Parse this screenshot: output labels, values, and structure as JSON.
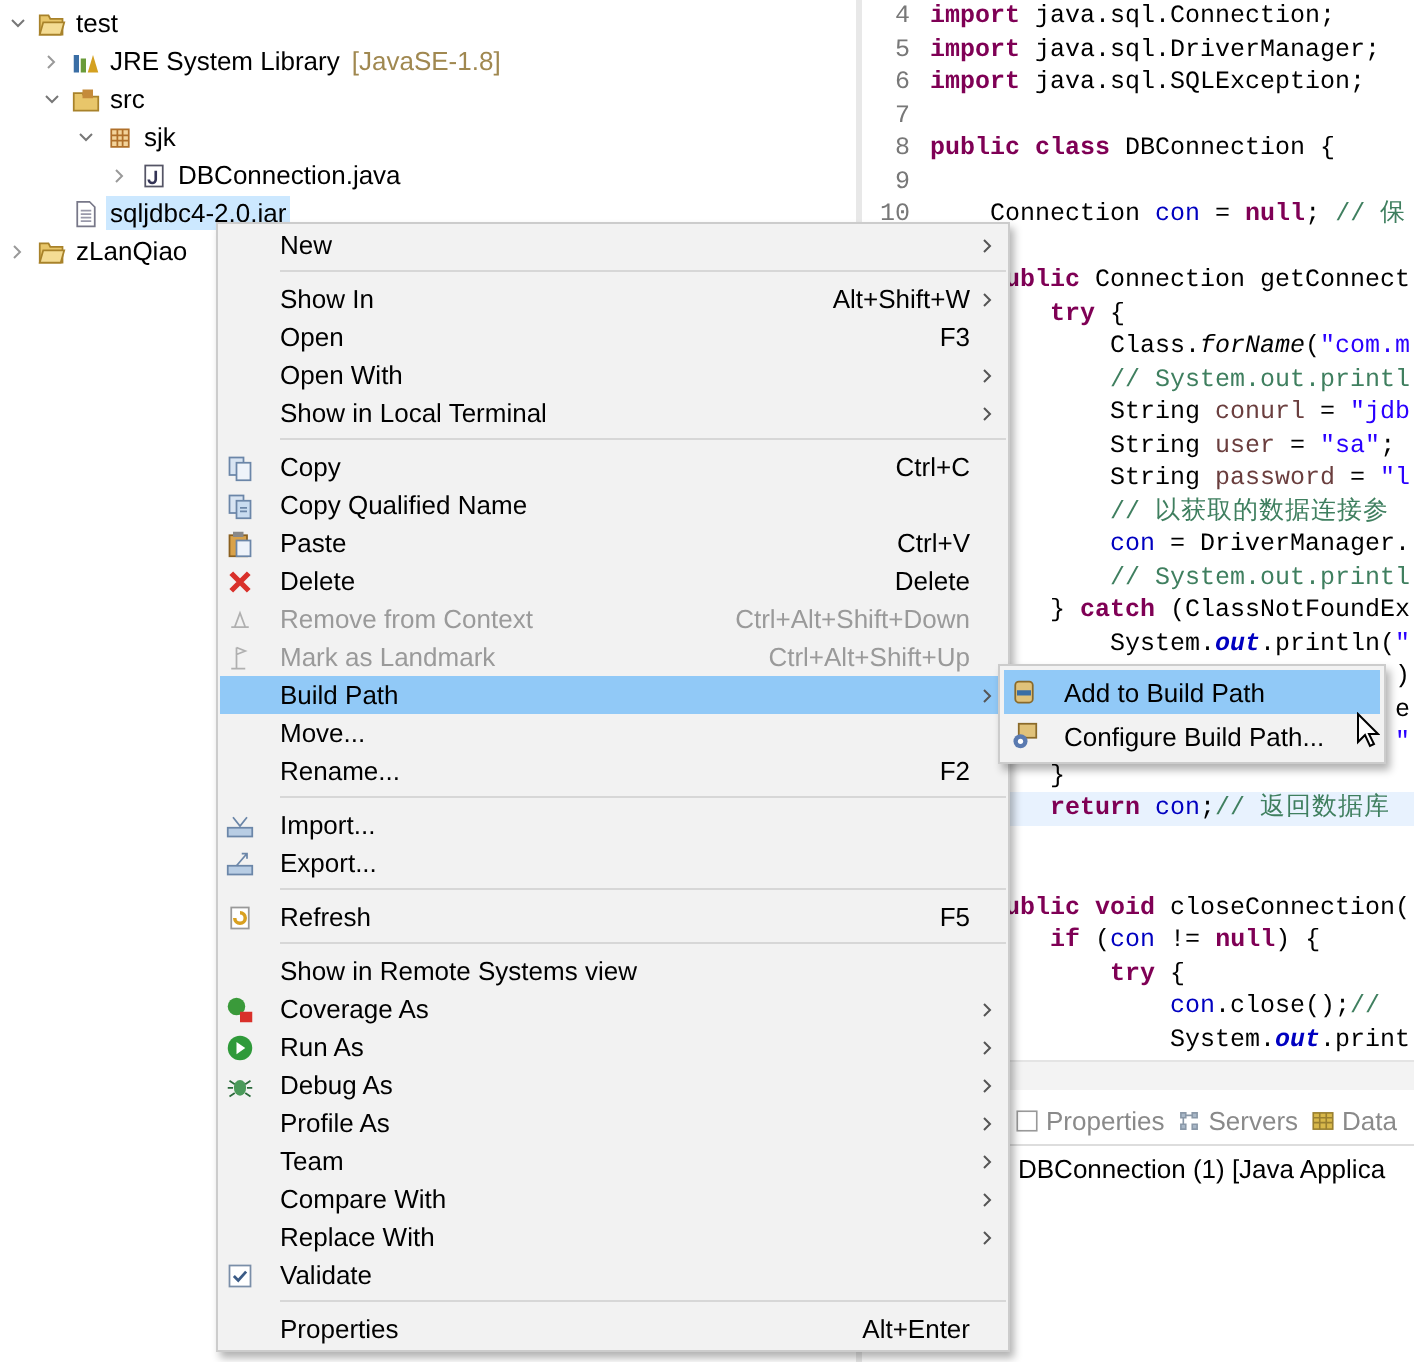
{
  "tree": [
    {
      "label": "test",
      "kind": "project",
      "expanded": true,
      "selected": false,
      "children": [
        {
          "label": "JRE System Library",
          "decoration": "[JavaSE-1.8]",
          "kind": "library",
          "expanded": false,
          "selected": false
        },
        {
          "label": "src",
          "kind": "source",
          "expanded": true,
          "selected": false,
          "children": [
            {
              "label": "sjk",
              "kind": "package",
              "expanded": true,
              "selected": false,
              "children": [
                {
                  "label": "DBConnection.java",
                  "kind": "java",
                  "expanded": false,
                  "selected": false
                }
              ]
            }
          ]
        },
        {
          "label": "sqljdbc4-2.0.jar",
          "kind": "file",
          "selected": true
        }
      ]
    },
    {
      "label": "zLanQiao",
      "kind": "project",
      "expanded": false,
      "selected": false
    }
  ],
  "editor": {
    "lines": [
      {
        "n": "4",
        "current": false,
        "t": [
          {
            "kind": "kw",
            "text": "import"
          },
          {
            "kind": "plain",
            "text": " java.sql.Connection;"
          }
        ]
      },
      {
        "n": "5",
        "current": false,
        "t": [
          {
            "kind": "kw",
            "text": "import"
          },
          {
            "kind": "plain",
            "text": " java.sql.DriverManager;"
          }
        ]
      },
      {
        "n": "6",
        "current": false,
        "t": [
          {
            "kind": "kw",
            "text": "import"
          },
          {
            "kind": "plain",
            "text": " java.sql.SQLException;"
          }
        ]
      },
      {
        "n": "7",
        "current": false
      },
      {
        "n": "8",
        "current": false,
        "t": [
          {
            "kind": "kw",
            "text": "public class"
          },
          {
            "kind": "plain",
            "text": " DBConnection {"
          }
        ]
      },
      {
        "n": "9",
        "current": false
      },
      {
        "n": "10",
        "current": false,
        "t": [
          {
            "kind": "plain",
            "text": "    Connection "
          },
          {
            "kind": "field",
            "text": "con"
          },
          {
            "kind": "plain",
            "text": " = "
          },
          {
            "kind": "kw",
            "text": "null"
          },
          {
            "kind": "plain",
            "text": "; "
          },
          {
            "kind": "comment",
            "text": "// 保"
          }
        ]
      },
      {
        "current": false
      },
      {
        "current": false,
        "t": [
          {
            "kind": "kw",
            "text": "     ublic"
          },
          {
            "kind": "plain",
            "text": " Connection getConnect"
          }
        ]
      },
      {
        "current": false,
        "t": [
          {
            "kind": "kw",
            "text": "        try"
          },
          {
            "kind": "plain",
            "text": " {"
          }
        ]
      },
      {
        "current": false,
        "t": [
          {
            "kind": "plain",
            "text": "            Class."
          },
          {
            "kind": "method",
            "text": "forName"
          },
          {
            "kind": "plain",
            "text": "("
          },
          {
            "kind": "str",
            "text": "\"com.m"
          }
        ]
      },
      {
        "current": false,
        "t": [
          {
            "kind": "comment",
            "text": "            // System.out.printl"
          }
        ]
      },
      {
        "current": false,
        "t": [
          {
            "kind": "plain",
            "text": "            String "
          },
          {
            "kind": "var",
            "text": "conurl"
          },
          {
            "kind": "plain",
            "text": " = "
          },
          {
            "kind": "str",
            "text": "\"jdb"
          }
        ]
      },
      {
        "current": false,
        "t": [
          {
            "kind": "plain",
            "text": "            String "
          },
          {
            "kind": "var",
            "text": "user"
          },
          {
            "kind": "plain",
            "text": " = "
          },
          {
            "kind": "str",
            "text": "\"sa\""
          },
          {
            "kind": "plain",
            "text": ";"
          }
        ]
      },
      {
        "current": false,
        "t": [
          {
            "kind": "plain",
            "text": "            String "
          },
          {
            "kind": "var",
            "text": "password"
          },
          {
            "kind": "plain",
            "text": " = "
          },
          {
            "kind": "str",
            "text": "\"l"
          }
        ]
      },
      {
        "current": false,
        "t": [
          {
            "kind": "comment",
            "text": "            // 以获取的数据连接参"
          }
        ]
      },
      {
        "current": false,
        "t": [
          {
            "kind": "field",
            "text": "            con"
          },
          {
            "kind": "plain",
            "text": " = DriverManager."
          }
        ]
      },
      {
        "current": false,
        "t": [
          {
            "kind": "comment",
            "text": "            // System.out.printl"
          }
        ]
      },
      {
        "current": false,
        "t": [
          {
            "kind": "plain",
            "text": "        } "
          },
          {
            "kind": "kw",
            "text": "catch"
          },
          {
            "kind": "plain",
            "text": " (ClassNotFoundEx"
          }
        ]
      },
      {
        "current": false,
        "t": [
          {
            "kind": "plain",
            "text": "            System."
          },
          {
            "kind": "static",
            "text": "out"
          },
          {
            "kind": "plain",
            "text": ".println("
          },
          {
            "kind": "str",
            "text": "\""
          }
        ]
      },
      {
        "current": false,
        "t": [
          {
            "kind": "plain",
            "text": "                               )"
          }
        ]
      },
      {
        "current": false,
        "t": [
          {
            "kind": "plain",
            "text": "                               e"
          }
        ]
      },
      {
        "current": false,
        "t": [
          {
            "kind": "str",
            "text": "                               \""
          }
        ]
      },
      {
        "current": false,
        "t": [
          {
            "kind": "plain",
            "text": "        }"
          }
        ]
      },
      {
        "current": true,
        "t": [
          {
            "kind": "kw",
            "text": "        return "
          },
          {
            "kind": "field",
            "text": "con"
          },
          {
            "kind": "plain",
            "text": ";"
          },
          {
            "kind": "comment",
            "text": "// 返回数据库"
          }
        ]
      },
      {
        "current": false
      },
      {
        "current": false
      },
      {
        "current": false,
        "t": [
          {
            "kind": "kw",
            "text": "     ublic void"
          },
          {
            "kind": "plain",
            "text": " closeConnection("
          }
        ]
      },
      {
        "current": false,
        "t": [
          {
            "kind": "kw",
            "text": "        if"
          },
          {
            "kind": "plain",
            "text": " ("
          },
          {
            "kind": "field",
            "text": "con"
          },
          {
            "kind": "plain",
            "text": " != "
          },
          {
            "kind": "kw",
            "text": "null"
          },
          {
            "kind": "plain",
            "text": ") {"
          }
        ]
      },
      {
        "current": false,
        "t": [
          {
            "kind": "kw",
            "text": "            try"
          },
          {
            "kind": "plain",
            "text": " {"
          }
        ]
      },
      {
        "current": false,
        "t": [
          {
            "kind": "field",
            "text": "                con"
          },
          {
            "kind": "plain",
            "text": ".close();"
          },
          {
            "kind": "comment",
            "text": "//"
          }
        ]
      },
      {
        "current": false,
        "t": [
          {
            "kind": "plain",
            "text": "                System."
          },
          {
            "kind": "static",
            "text": "out"
          },
          {
            "kind": "plain",
            "text": ".print"
          }
        ]
      }
    ]
  },
  "panel": {
    "tabs": [
      {
        "label": "Properties"
      },
      {
        "label": "Servers"
      },
      {
        "label": "Data"
      }
    ],
    "console": "DBConnection (1) [Java Applica"
  },
  "menu": [
    {
      "kind": "item",
      "label": "New",
      "submenu": true,
      "selected": false,
      "disabled": false
    },
    {
      "kind": "separator"
    },
    {
      "kind": "item",
      "label": "Show In",
      "shortcut": "Alt+Shift+W",
      "submenu": true,
      "selected": false,
      "disabled": false
    },
    {
      "kind": "item",
      "label": "Open",
      "shortcut": "F3",
      "submenu": false,
      "selected": false,
      "disabled": false
    },
    {
      "kind": "item",
      "label": "Open With",
      "submenu": true,
      "selected": false,
      "disabled": false
    },
    {
      "kind": "item",
      "label": "Show in Local Terminal",
      "submenu": true,
      "selected": false,
      "disabled": false
    },
    {
      "kind": "separator"
    },
    {
      "kind": "copy",
      "label": "Copy",
      "shortcut": "Ctrl+C",
      "submenu": false,
      "selected": false,
      "disabled": false
    },
    {
      "kind": "copyname",
      "label": "Copy Qualified Name",
      "submenu": false,
      "selected": false,
      "disabled": false
    },
    {
      "kind": "paste",
      "label": "Paste",
      "shortcut": "Ctrl+V",
      "submenu": false,
      "selected": false,
      "disabled": false
    },
    {
      "kind": "delete",
      "label": "Delete",
      "shortcut": "Delete",
      "submenu": false,
      "selected": false,
      "disabled": false
    },
    {
      "kind": "remove",
      "label": "Remove from Context",
      "shortcut": "Ctrl+Alt+Shift+Down",
      "submenu": false,
      "selected": false,
      "disabled": true
    },
    {
      "kind": "landmark",
      "label": "Mark as Landmark",
      "shortcut": "Ctrl+Alt+Shift+Up",
      "submenu": false,
      "selected": false,
      "disabled": true
    },
    {
      "kind": "item",
      "label": "Build Path",
      "submenu": true,
      "selected": true,
      "disabled": false
    },
    {
      "kind": "item",
      "label": "Move...",
      "submenu": false,
      "selected": false,
      "disabled": false
    },
    {
      "kind": "item",
      "label": "Rename...",
      "shortcut": "F2",
      "submenu": false,
      "selected": false,
      "disabled": false
    },
    {
      "kind": "separator"
    },
    {
      "kind": "import",
      "label": "Import...",
      "submenu": false,
      "selected": false,
      "disabled": false
    },
    {
      "kind": "export",
      "label": "Export...",
      "submenu": false,
      "selected": false,
      "disabled": false
    },
    {
      "kind": "separator"
    },
    {
      "kind": "refresh",
      "label": "Refresh",
      "shortcut": "F5",
      "submenu": false,
      "selected": false,
      "disabled": false
    },
    {
      "kind": "separator"
    },
    {
      "kind": "item",
      "label": "Show in Remote Systems view",
      "submenu": false,
      "selected": false,
      "disabled": false
    },
    {
      "kind": "coverage",
      "label": "Coverage As",
      "submenu": true,
      "selected": false,
      "disabled": false
    },
    {
      "kind": "run",
      "label": "Run As",
      "submenu": true,
      "selected": false,
      "disabled": false
    },
    {
      "kind": "debug",
      "label": "Debug As",
      "submenu": true,
      "selected": false,
      "disabled": false
    },
    {
      "kind": "item",
      "label": "Profile As",
      "submenu": true,
      "selected": false,
      "disabled": false
    },
    {
      "kind": "item",
      "label": "Team",
      "submenu": true,
      "selected": false,
      "disabled": false
    },
    {
      "kind": "item",
      "label": "Compare With",
      "submenu": true,
      "selected": false,
      "disabled": false
    },
    {
      "kind": "item",
      "label": "Replace With",
      "submenu": true,
      "selected": false,
      "disabled": false
    },
    {
      "kind": "check",
      "label": "Validate",
      "checked": true,
      "submenu": false,
      "selected": false,
      "disabled": false
    },
    {
      "kind": "separator"
    },
    {
      "kind": "item",
      "label": "Properties",
      "shortcut": "Alt+Enter",
      "submenu": false,
      "selected": false,
      "disabled": false
    }
  ],
  "submenu": [
    {
      "kind": "jar",
      "label": "Add to Build Path",
      "selected": true
    },
    {
      "kind": "config",
      "label": "Configure Build Path...",
      "selected": false
    }
  ]
}
